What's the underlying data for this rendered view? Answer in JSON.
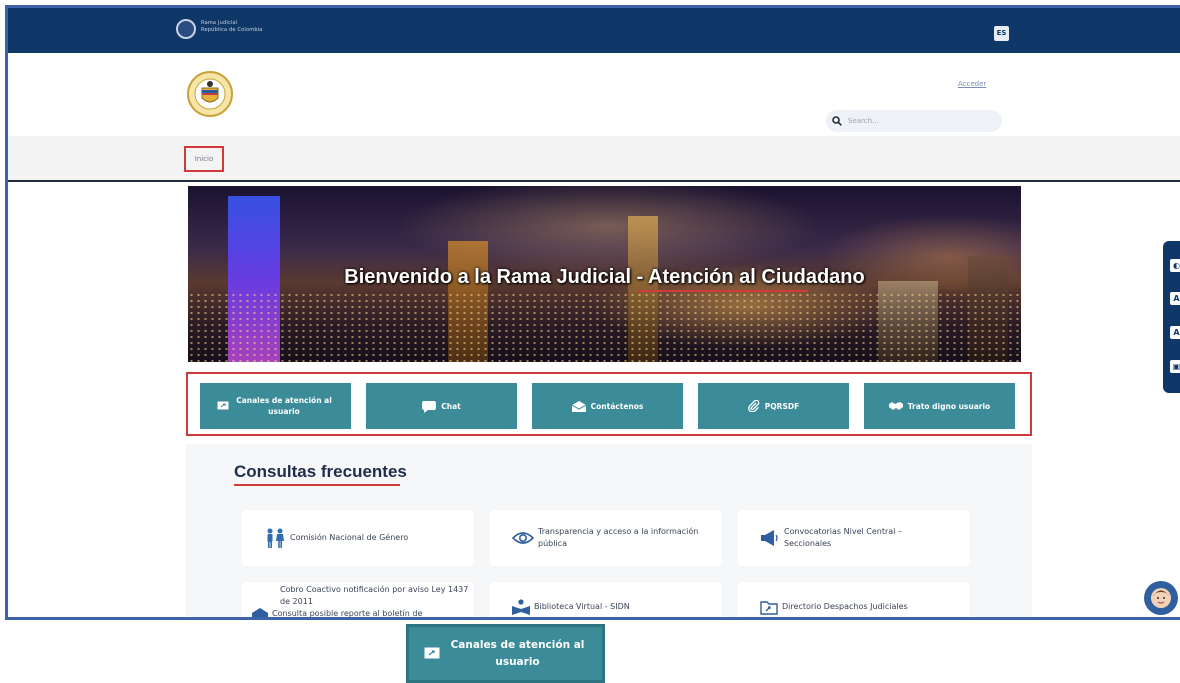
{
  "topbar": {
    "brand_line1": "Rama Judicial",
    "brand_line2": "República de Colombia",
    "language": "ES",
    "color": "#0f3768"
  },
  "header": {
    "login_label": "Acceder",
    "search_placeholder": "Search..."
  },
  "nav": {
    "home_label": "Inicio"
  },
  "hero": {
    "title": "Bienvenido a la Rama Judicial - Atención al Ciudadano"
  },
  "quick_buttons": [
    {
      "label": "Canales de atención al usuario",
      "icon": "monitor-icon"
    },
    {
      "label": "Chat",
      "icon": "chat-bubble-icon"
    },
    {
      "label": "Contáctenos",
      "icon": "envelope-icon"
    },
    {
      "label": "PQRSDF",
      "icon": "paperclip-icon"
    },
    {
      "label": "Trato digno usuario",
      "icon": "handshake-icon"
    }
  ],
  "faq": {
    "heading": "Consultas frecuentes",
    "cards": [
      {
        "label": "Comisión Nacional de Género",
        "icon": "people-icon"
      },
      {
        "label": "Transparencia y acceso a la información pública",
        "icon": "eye-icon"
      },
      {
        "label": "Convocatorias Nivel Central – Seccionales",
        "icon": "megaphone-icon"
      },
      {
        "label": "Cobro Coactivo notificación por aviso Ley 1437 de 2011",
        "label2": "Consulta posible reporte al boletín de",
        "icon": "envelope-open-icon"
      },
      {
        "label": "Biblioteca Virtual - SIDN",
        "icon": "book-reader-icon"
      },
      {
        "label": "Directorio Despachos Judiciales",
        "icon": "folder-icon"
      }
    ]
  },
  "side_tools": [
    "◐",
    "A",
    "A",
    "▣"
  ],
  "zoomed_button": {
    "label": "Canales de atención al usuario"
  },
  "colors": {
    "teal": "#3b8c98",
    "highlight_red": "#d23a3a",
    "navy": "#0f3768"
  }
}
